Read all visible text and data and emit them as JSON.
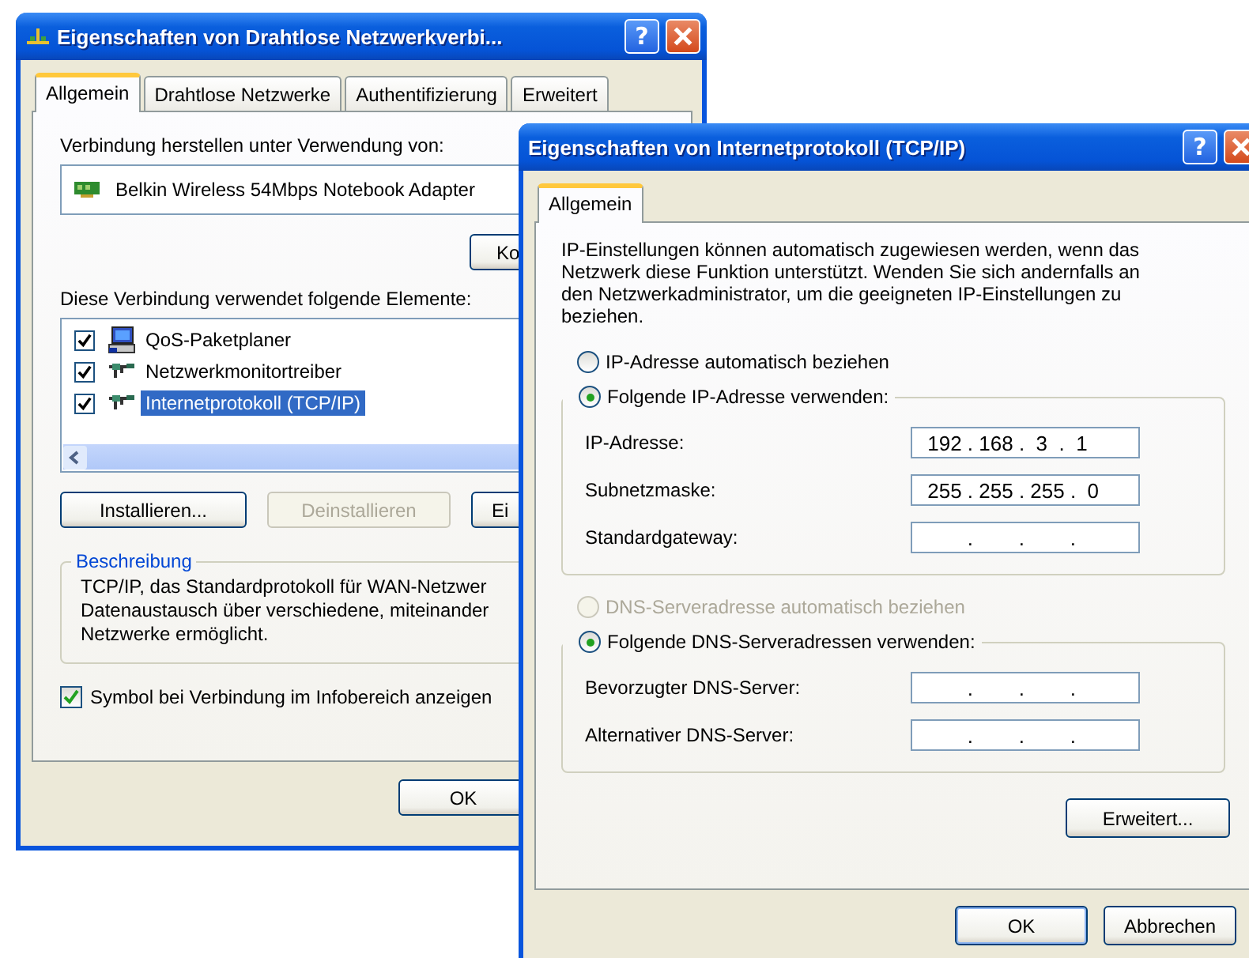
{
  "background_window": {
    "title": "Eigenschaften von Drahtlose Netzwerkverbi...",
    "help_glyph": "?",
    "tabs": [
      {
        "label": "Allgemein",
        "selected": true
      },
      {
        "label": "Drahtlose Netzwerke",
        "selected": false
      },
      {
        "label": "Authentifizierung",
        "selected": false
      },
      {
        "label": "Erweitert",
        "selected": false
      }
    ],
    "connect_label": "Verbindung herstellen unter Verwendung von:",
    "adapter": "Belkin Wireless 54Mbps Notebook Adapter",
    "configure_button": "Ko",
    "components_label": "Diese Verbindung verwendet folgende Elemente:",
    "components": [
      {
        "label": "QoS-Paketplaner",
        "kind": "computer",
        "checked": true,
        "selected": false
      },
      {
        "label": "Netzwerkmonitortreiber",
        "kind": "protocol",
        "checked": true,
        "selected": false
      },
      {
        "label": "Internetprotokoll (TCP/IP)",
        "kind": "protocol",
        "checked": true,
        "selected": true
      }
    ],
    "buttons": [
      {
        "label": "Installieren...",
        "disabled": false
      },
      {
        "label": "Deinstallieren",
        "disabled": true
      },
      {
        "label": "Ei",
        "disabled": false
      }
    ],
    "description_title": "Beschreibung",
    "description_lines": [
      "TCP/IP, das Standardprotokoll für WAN-Netzwer",
      "Datenaustausch über verschiedene, miteinander",
      "Netzwerke ermöglicht."
    ],
    "tray_option": {
      "label": "Symbol bei Verbindung im Infobereich anzeigen",
      "checked": true
    },
    "ok_button": "OK"
  },
  "front_window": {
    "title": "Eigenschaften von Internetprotokoll (TCP/IP)",
    "help_glyph": "?",
    "tabs": [
      {
        "label": "Allgemein",
        "selected": true
      }
    ],
    "intro": "IP-Einstellungen können automatisch zugewiesen werden, wenn das Netzwerk diese Funktion unterstützt. Wenden Sie sich andernfalls an den Netzwerkadministrator, um die geeigneten IP-Einstellungen zu beziehen.",
    "sections": [
      {
        "auto_option": {
          "label": "IP-Adresse automatisch beziehen",
          "selected": false,
          "disabled": false
        },
        "manual_group": {
          "label": "Folgende IP-Adresse verwenden:",
          "selected": true,
          "fields": [
            {
              "label": "IP-Adresse:",
              "value": " 192 . 168 .  3  .  1"
            },
            {
              "label": "Subnetzmaske:",
              "value": " 255 . 255 . 255 .  0"
            },
            {
              "label": "Standardgateway:",
              "value": "        .        .        ."
            }
          ]
        }
      },
      {
        "auto_option": {
          "label": "DNS-Serveradresse automatisch beziehen",
          "selected": false,
          "disabled": true
        },
        "manual_group": {
          "label": "Folgende DNS-Serveradressen verwenden:",
          "selected": true,
          "fields": [
            {
              "label": "Bevorzugter DNS-Server:",
              "value": "        .        .        ."
            },
            {
              "label": "Alternativer DNS-Server:",
              "value": "        .        .        ."
            }
          ]
        }
      }
    ],
    "advanced_button": "Erweitert...",
    "buttons": [
      "OK",
      "Abbrechen"
    ]
  }
}
